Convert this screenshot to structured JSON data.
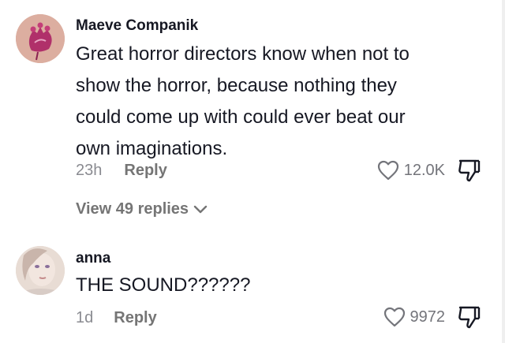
{
  "comments": [
    {
      "username": "Maeve Companik",
      "text_lines": [
        "Great horror directors know when not to",
        "show the horror, because nothing they",
        "could come up with could ever beat our",
        "own imaginations."
      ],
      "time": "23h",
      "reply_label": "Reply",
      "likes": "12.0K",
      "view_replies": "View 49 replies",
      "avatar_colors": {
        "bg": "#d9a89a",
        "flower": "#b0306a"
      }
    },
    {
      "username": "anna",
      "text": "THE SOUND??????",
      "time": "1d",
      "reply_label": "Reply",
      "likes": "9972"
    }
  ],
  "colors": {
    "text": "#161823",
    "muted": "#8a8b91",
    "reply": "#757575"
  },
  "icons": {
    "like": "heart-outline-icon",
    "dislike": "thumbs-down-icon",
    "expand": "chevron-down-icon"
  }
}
